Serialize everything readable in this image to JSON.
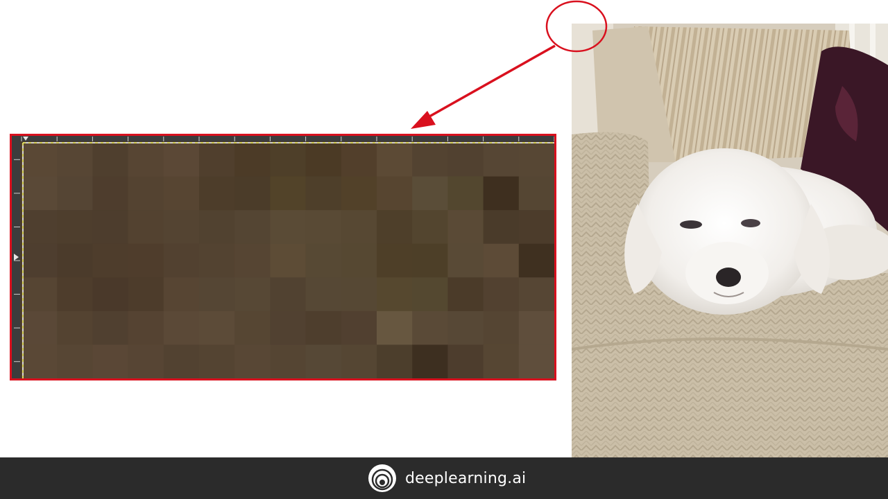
{
  "colors": {
    "annotation": "#d9101e",
    "selection_outline": "#e8e64a",
    "footer_bg": "#2b2b2b",
    "footer_text": "#ffffff"
  },
  "zoom_view": {
    "description_icon": "pixel-grid",
    "cell_colors": [
      [
        "#5a4835",
        "#574634",
        "#4f3f2e",
        "#574533",
        "#5b4836",
        "#503f2d",
        "#4c3b27",
        "#4e3f29",
        "#4b3a25",
        "#523f2b",
        "#5c4a35",
        "#534331",
        "#514130",
        "#564634",
        "#574734"
      ],
      [
        "#5a4937",
        "#554534",
        "#4e3d2d",
        "#544331",
        "#574532",
        "#4d3d2a",
        "#4b3c29",
        "#524329",
        "#4e3f2a",
        "#524129",
        "#574530",
        "#5a4d38",
        "#53472f",
        "#3e2f1f",
        "#554633"
      ],
      [
        "#4f3f2f",
        "#4e3e2d",
        "#4d3d2d",
        "#534230",
        "#544432",
        "#514230",
        "#544533",
        "#5a4b36",
        "#594a35",
        "#574833",
        "#4e3f2a",
        "#53452f",
        "#5a4a36",
        "#4a3b2a",
        "#4c3c2b"
      ],
      [
        "#4e3e2f",
        "#4b3b2b",
        "#4e3d2c",
        "#4f3d2c",
        "#524130",
        "#534331",
        "#564533",
        "#5d4c36",
        "#574934",
        "#564832",
        "#4e3f28",
        "#4d3f28",
        "#594a36",
        "#5d4b37",
        "#3f3020"
      ],
      [
        "#564533",
        "#4e3d2c",
        "#4a392a",
        "#4d3c2b",
        "#574533",
        "#554634",
        "#574835",
        "#514231",
        "#564835",
        "#564834",
        "#56482f",
        "#544830",
        "#4b3b29",
        "#524130",
        "#564634"
      ],
      [
        "#5a4837",
        "#544331",
        "#504030",
        "#554332",
        "#5b4937",
        "#5c4b38",
        "#564633",
        "#514131",
        "#4e3e2d",
        "#514030",
        "#675740",
        "#5a4a37",
        "#574836",
        "#554533",
        "#5f4e3c"
      ],
      [
        "#5a4836",
        "#574634",
        "#5a4736",
        "#574534",
        "#524231",
        "#544432",
        "#584735",
        "#554533",
        "#564836",
        "#554633",
        "#4c3e2c",
        "#3d2f20",
        "#4d3d2d",
        "#564633",
        "#5f4e3c"
      ]
    ]
  },
  "brand": {
    "name": "deeplearning.ai",
    "logo_icon": "deeplearning-logo-icon"
  }
}
